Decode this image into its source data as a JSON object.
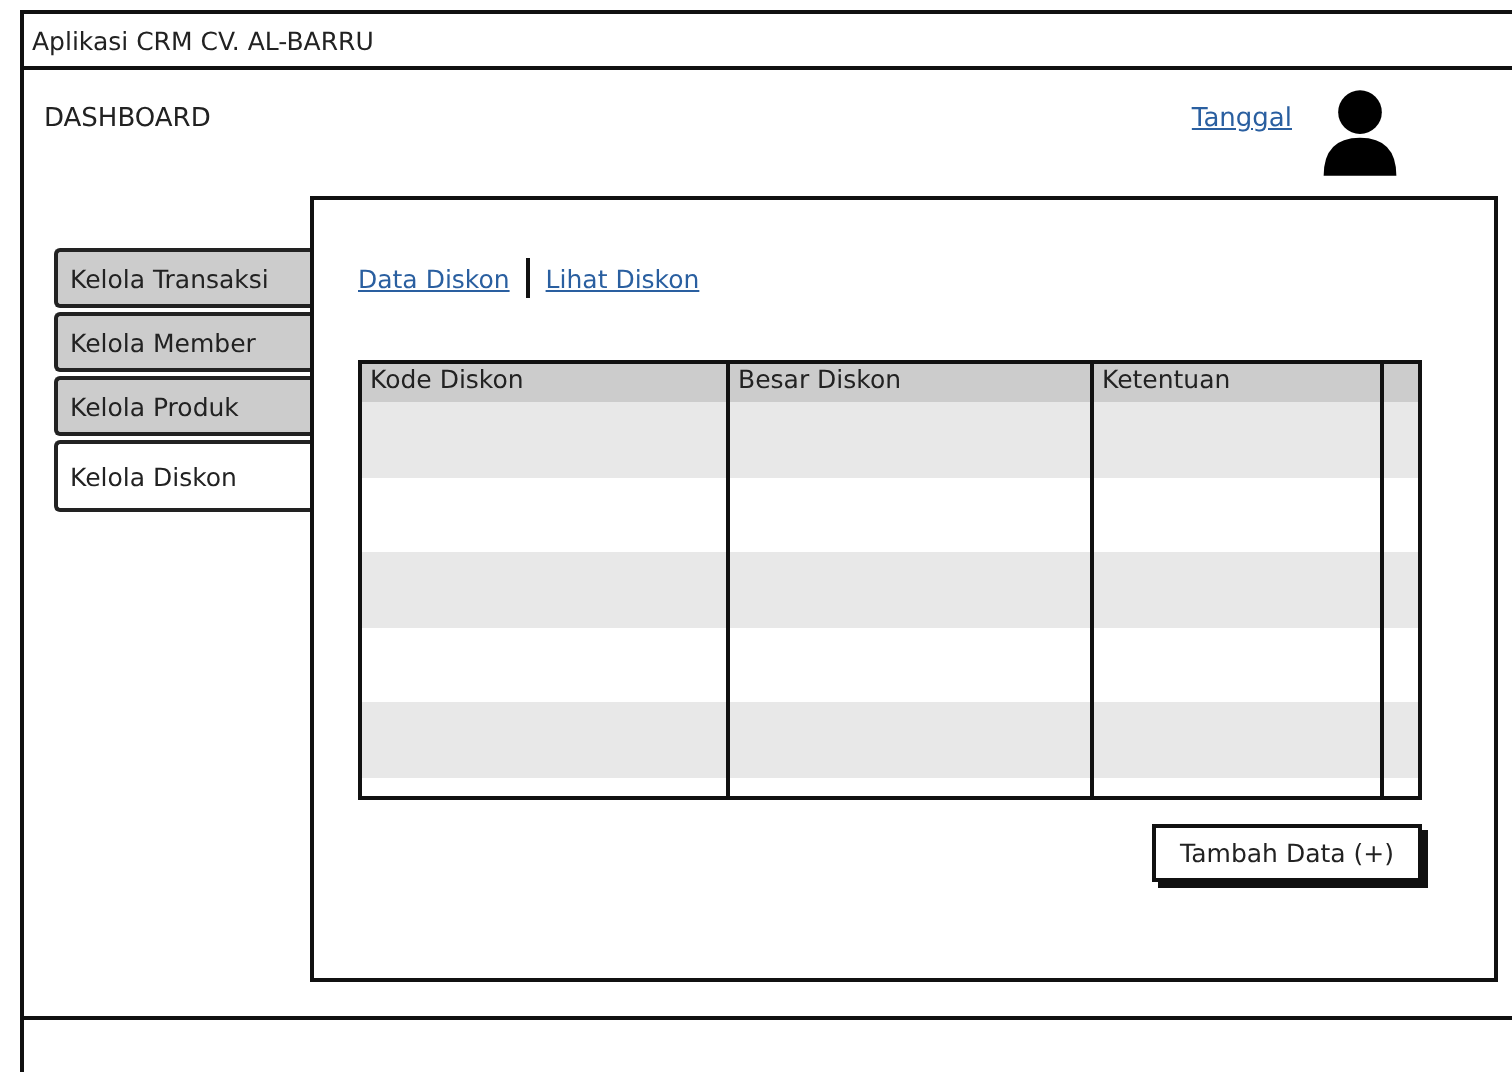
{
  "window": {
    "title": "Aplikasi CRM CV. AL-BARRU"
  },
  "header": {
    "title": "DASHBOARD",
    "date_link": "Tanggal"
  },
  "tabs": [
    {
      "label": "Kelola Transaksi",
      "selected": false
    },
    {
      "label": "Kelola Member",
      "selected": false
    },
    {
      "label": "Kelola Produk",
      "selected": false
    },
    {
      "label": "Kelola Diskon",
      "selected": true
    }
  ],
  "links": [
    "Data Diskon",
    "Lihat Diskon"
  ],
  "table": {
    "columns": [
      "Kode Diskon",
      "Besar Diskon",
      "Ketentuan"
    ]
  },
  "buttons": [
    "Tambah Data (+)"
  ]
}
